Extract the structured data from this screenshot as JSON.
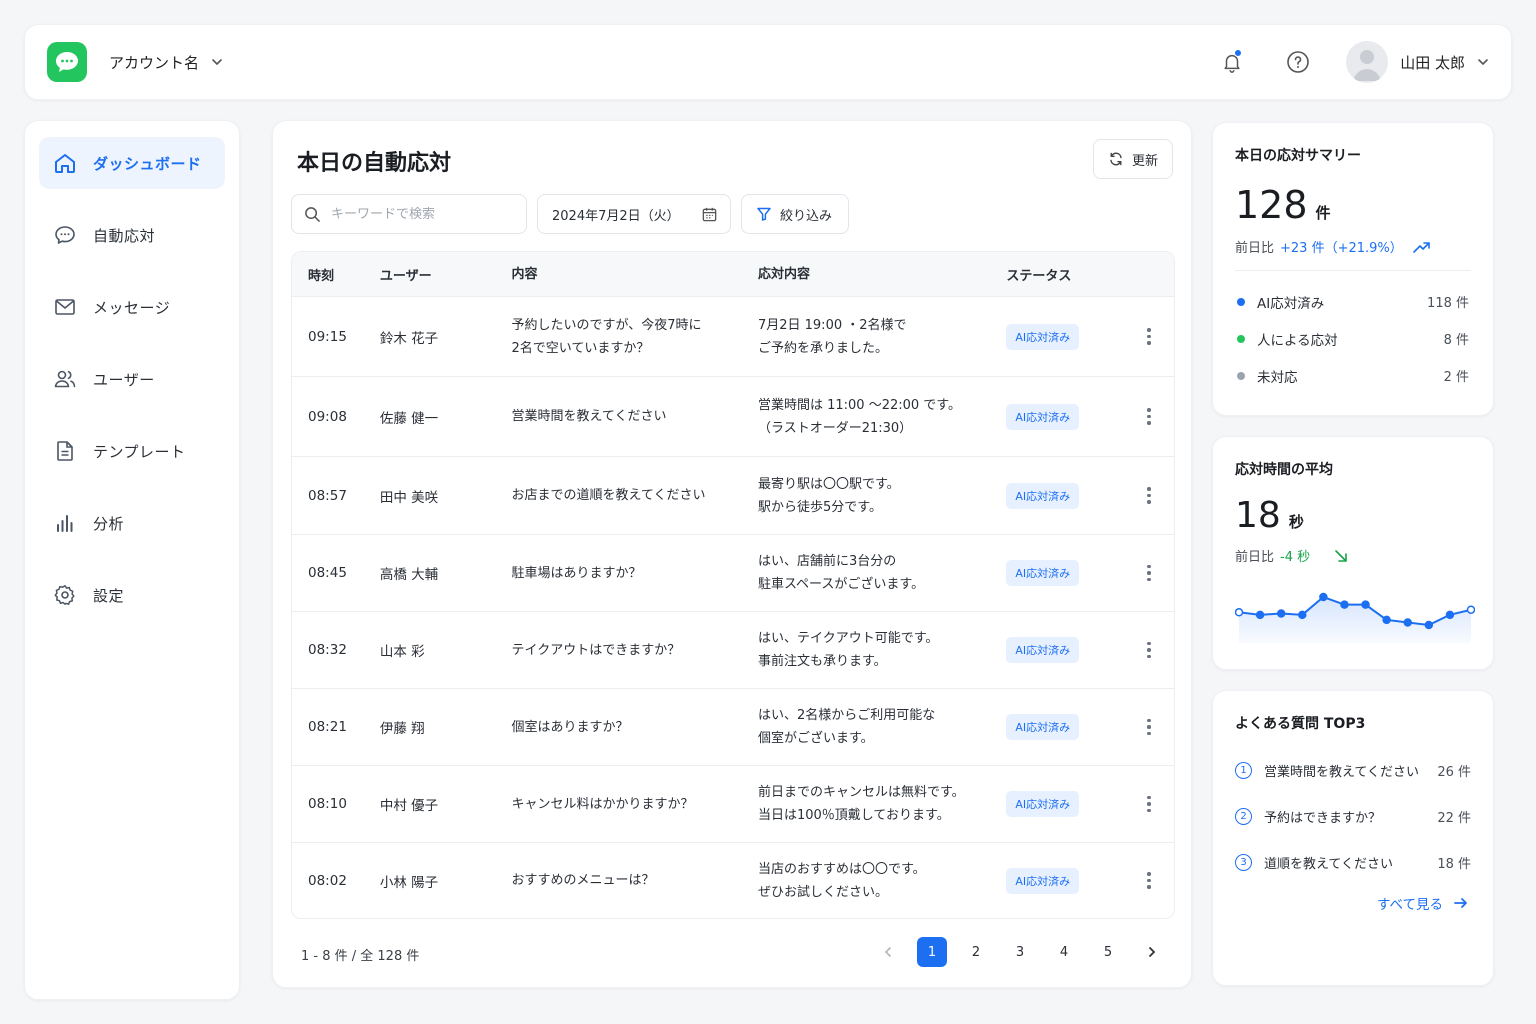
{
  "header": {
    "account_name": "アカウント名",
    "user_name": "山田 太郎"
  },
  "sidebar": {
    "items": [
      {
        "label": "ダッシュボード",
        "icon": "home-icon",
        "active": true
      },
      {
        "label": "自動応対",
        "icon": "chat-icon",
        "active": false
      },
      {
        "label": "メッセージ",
        "icon": "mail-icon",
        "active": false
      },
      {
        "label": "ユーザー",
        "icon": "users-icon",
        "active": false
      },
      {
        "label": "テンプレート",
        "icon": "document-icon",
        "active": false
      },
      {
        "label": "分析",
        "icon": "bar-chart-icon",
        "active": false
      },
      {
        "label": "設定",
        "icon": "gear-icon",
        "active": false
      }
    ]
  },
  "main": {
    "title": "本日の自動応対",
    "refresh_label": "更新",
    "search_placeholder": "キーワードで検索",
    "date_value": "2024年7月2日（火）",
    "filter_label": "絞り込み",
    "columns": [
      "時刻",
      "ユーザー",
      "内容",
      "応対内容",
      "ステータス"
    ],
    "rows": [
      {
        "time": "09:15",
        "user": "鈴木 花子",
        "content": [
          "予約したいのですが、今夜7時に",
          "2名で空いていますか？"
        ],
        "reply": [
          "7月2日 19:00 ・2名様で",
          "ご予約を承りました。"
        ],
        "status": "AI応対済み"
      },
      {
        "time": "09:08",
        "user": "佐藤 健一",
        "content": [
          "営業時間を教えてください"
        ],
        "reply": [
          "営業時間は 11:00 〜22:00 です。",
          "（ラストオーダー21:30）"
        ],
        "status": "AI応対済み"
      },
      {
        "time": "08:57",
        "user": "田中 美咲",
        "content": [
          "お店までの道順を教えてください"
        ],
        "reply": [
          "最寄り駅は〇〇駅です。",
          "駅から徒歩5分です。"
        ],
        "status": "AI応対済み"
      },
      {
        "time": "08:45",
        "user": "高橋 大輔",
        "content": [
          "駐車場はありますか？"
        ],
        "reply": [
          "はい、店舗前に3台分の",
          "駐車スペースがございます。"
        ],
        "status": "AI応対済み"
      },
      {
        "time": "08:32",
        "user": "山本 彩",
        "content": [
          "テイクアウトはできますか？"
        ],
        "reply": [
          "はい、テイクアウト可能です。",
          "事前注文も承ります。"
        ],
        "status": "AI応対済み"
      },
      {
        "time": "08:21",
        "user": "伊藤 翔",
        "content": [
          "個室はありますか？"
        ],
        "reply": [
          "はい、2名様からご利用可能な",
          "個室がございます。"
        ],
        "status": "AI応対済み"
      },
      {
        "time": "08:10",
        "user": "中村 優子",
        "content": [
          "キャンセル料はかかりますか？"
        ],
        "reply": [
          "前日までのキャンセルは無料です。",
          "当日は100％頂戴しております。"
        ],
        "status": "AI応対済み"
      },
      {
        "time": "08:02",
        "user": "小林 陽子",
        "content": [
          "おすすめのメニューは？"
        ],
        "reply": [
          "当店のおすすめは〇〇です。",
          "ぜひお試しください。"
        ],
        "status": "AI応対済み"
      }
    ],
    "pagination": {
      "info": "1 - 8 件 / 全 128 件",
      "pages": [
        "1",
        "2",
        "3",
        "4",
        "5"
      ],
      "current": "1"
    }
  },
  "summary": {
    "title": "本日の応対サマリー",
    "total": "128",
    "unit": "件",
    "delta_prefix": "前日比",
    "delta_value": "+23 件（+21.9%）",
    "breakdown": [
      {
        "label": "AI応対済み",
        "count": "118 件",
        "color": "#1d6ff2"
      },
      {
        "label": "人による応対",
        "count": "8 件",
        "color": "#22c55e"
      },
      {
        "label": "未対応",
        "count": "2 件",
        "color": "#9ca3af"
      }
    ]
  },
  "avg_time": {
    "title": "応対時間の平均",
    "value": "18",
    "unit": "秒",
    "delta_prefix": "前日比",
    "delta_value": "-4 秒",
    "sparkline": [
      22,
      21,
      21.5,
      21,
      28,
      25,
      25,
      19,
      18,
      17,
      21,
      23
    ]
  },
  "faq": {
    "title": "よくある質問 TOP3",
    "items": [
      {
        "rank": "1",
        "label": "営業時間を教えてください",
        "count": "26 件"
      },
      {
        "rank": "2",
        "label": "予約はできますか？",
        "count": "22 件"
      },
      {
        "rank": "3",
        "label": "道順を教えてください",
        "count": "18 件"
      }
    ],
    "see_all": "すべて見る"
  },
  "colors": {
    "accent": "#1d6ff2",
    "brand": "#22c55e",
    "positive": "#16a34a"
  }
}
